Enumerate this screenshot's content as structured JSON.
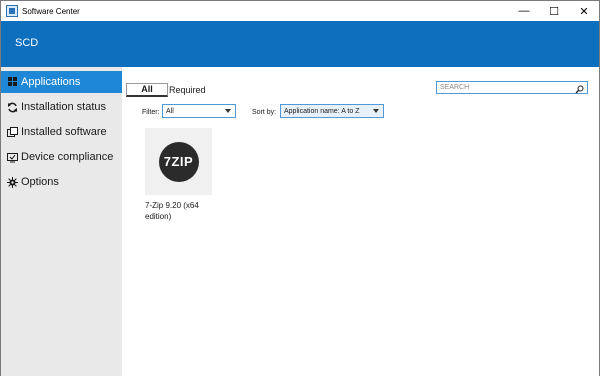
{
  "window": {
    "title": "Software Center",
    "controls": {
      "minimize": "—",
      "maximize": "☐",
      "close": "✕"
    }
  },
  "header": {
    "title": "SCD",
    "color": "#0d6fbd"
  },
  "sidebar": {
    "items": [
      {
        "label": "Applications",
        "icon": "apps-grid-icon",
        "active": true
      },
      {
        "label": "Installation status",
        "icon": "refresh-icon",
        "active": false
      },
      {
        "label": "Installed software",
        "icon": "installed-software-icon",
        "active": false
      },
      {
        "label": "Device compliance",
        "icon": "device-compliance-icon",
        "active": false
      },
      {
        "label": "Options",
        "icon": "gear-icon",
        "active": false
      }
    ],
    "active_color": "#1e88d6"
  },
  "tabs": {
    "all": "All",
    "required": "Required"
  },
  "filter": {
    "label": "Filter:",
    "value": "All"
  },
  "sort": {
    "label": "Sort by:",
    "value": "Application name: A to Z"
  },
  "search": {
    "placeholder": "SEARCH"
  },
  "apps": [
    {
      "name": "7-Zip 9.20 (x64 edition)",
      "logo_text": "7ZIP"
    }
  ]
}
